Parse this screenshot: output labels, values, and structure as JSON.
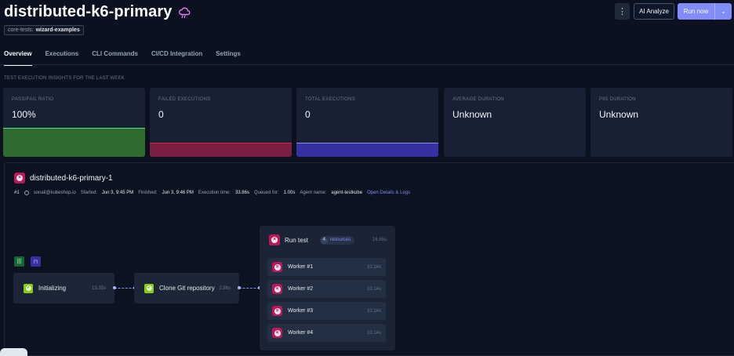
{
  "header": {
    "title": "distributed-k6-primary",
    "tag_key": "core-tests:",
    "tag_value": "wizard-examples",
    "kebab_icon": "more-vertical-icon",
    "ai_button": "AI Analyze",
    "run_button": "Run now"
  },
  "tabs": [
    {
      "label": "Overview",
      "active": true
    },
    {
      "label": "Executions"
    },
    {
      "label": "CLI Commands"
    },
    {
      "label": "CI/CD Integration"
    },
    {
      "label": "Settings"
    }
  ],
  "insights_label": "TEST EXECUTION INSIGHTS FOR THE LAST WEEK",
  "cards": [
    {
      "label": "PASS/FAIL RATIO",
      "value": "100%",
      "color": "#2f6b2f",
      "accent": "#4ade80"
    },
    {
      "label": "FAILED EXECUTIONS",
      "value": "0",
      "color": "#7a1e44",
      "accent": "#e11d48"
    },
    {
      "label": "TOTAL EXECUTIONS",
      "value": "0",
      "color": "#3730a3",
      "accent": "#818cf8"
    },
    {
      "label": "AVERAGE DURATION",
      "value": "Unknown"
    },
    {
      "label": "P95 DURATION",
      "value": "Unknown"
    }
  ],
  "execution": {
    "name": "distributed-k6-primary-1",
    "number": "#1",
    "user": "sonali@kubeshop.io",
    "started_label": "Started:",
    "started": "Jun 3, 9:45 PM",
    "finished_label": "Finished:",
    "finished": "Jun 3, 9:46 PM",
    "exec_time_label": "Execution time:",
    "exec_time": "33.86s",
    "queued_label": "Queued for:",
    "queued": "1.00s",
    "agent_label": "Agent name:",
    "agent": "agent-testkube",
    "details_link": "Open Details & Logs"
  },
  "flow": {
    "step1": {
      "label": "Initializing",
      "time": "13.35s"
    },
    "step2": {
      "label": "Clone Git repository",
      "time": "2.86s"
    },
    "group": {
      "label": "Run test",
      "resources_count": "4",
      "resources_label": "resources",
      "time": "16.65s"
    },
    "workers": [
      {
        "label": "Worker #1",
        "time": "10.14s"
      },
      {
        "label": "Worker #2",
        "time": "10.14s"
      },
      {
        "label": "Worker #3",
        "time": "10.14s"
      },
      {
        "label": "Worker #4",
        "time": "10.14s"
      }
    ]
  },
  "colors": {
    "primary": "#818cf8",
    "error": "#be185d",
    "success": "#84cc16"
  }
}
